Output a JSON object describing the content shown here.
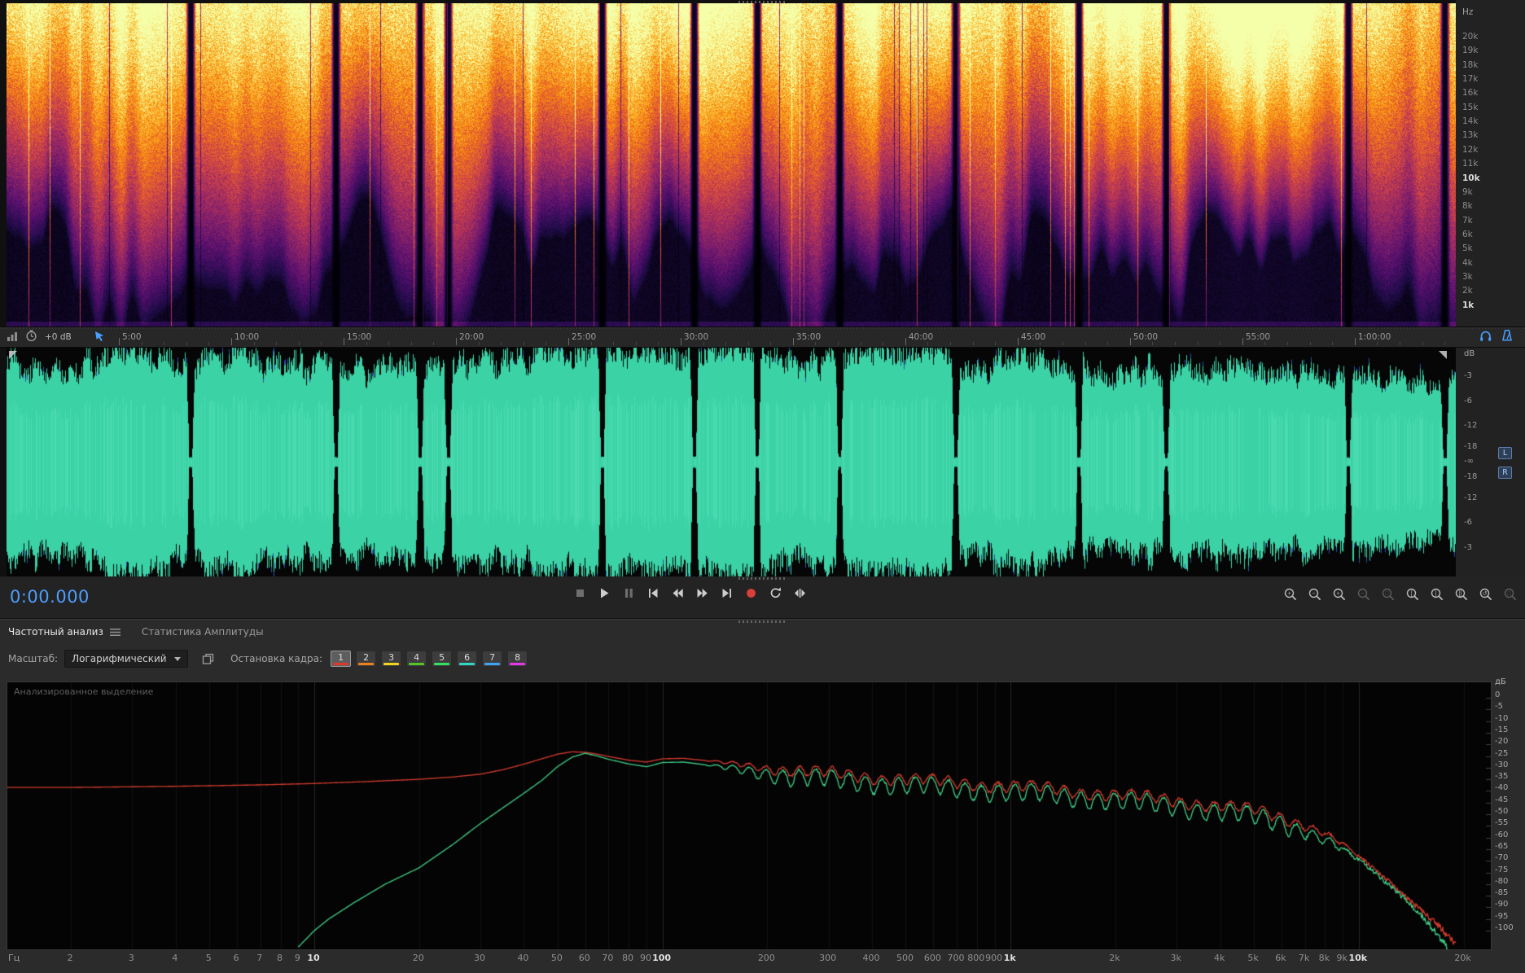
{
  "spectrogram": {
    "unit": "Hz",
    "freq_labels": [
      "20k",
      "19k",
      "18k",
      "17k",
      "16k",
      "15k",
      "14k",
      "13k",
      "12k",
      "11k",
      "10k",
      "9k",
      "8k",
      "7k",
      "6k",
      "5k",
      "4k",
      "3k",
      "2k",
      "1k"
    ],
    "bold_labels": [
      "10k",
      "1k"
    ]
  },
  "ruler": {
    "gain_label": "+0 dB",
    "interval_sec": 300,
    "times": [
      "5:00",
      "10:00",
      "15:00",
      "20:00",
      "25:00",
      "30:00",
      "35:00",
      "40:00",
      "45:00",
      "50:00",
      "55:00",
      "1:00:00"
    ]
  },
  "waveform": {
    "unit": "dB",
    "scale_labels": [
      "-3",
      "-6",
      "-12",
      "-18",
      "-∞",
      "-18",
      "-12",
      "-6",
      "-3"
    ],
    "channels": [
      "L",
      "R"
    ],
    "color": "#3bd2a5",
    "duration_sec": 3870,
    "gaps_sec": [
      491,
      879,
      1104,
      1179,
      1590,
      1836,
      2004,
      2224,
      2534,
      2863,
      3096,
      3582,
      3840
    ]
  },
  "transport": {
    "time_display": "0:00.000",
    "buttons": [
      {
        "name": "stop",
        "dim": true
      },
      {
        "name": "play",
        "dim": false
      },
      {
        "name": "pause",
        "dim": true
      },
      {
        "name": "skip-to-start",
        "dim": false
      },
      {
        "name": "rewind",
        "dim": false
      },
      {
        "name": "fast-forward",
        "dim": false
      },
      {
        "name": "skip-to-end",
        "dim": false
      },
      {
        "name": "record",
        "dim": false
      },
      {
        "name": "loop-playback",
        "dim": false
      },
      {
        "name": "skip-playhead",
        "dim": false
      }
    ],
    "zoom_buttons": [
      {
        "name": "zoom-in-time",
        "sub": "+",
        "dim": false
      },
      {
        "name": "zoom-out-time",
        "sub": "−",
        "dim": false
      },
      {
        "name": "zoom-in-amplitude",
        "sub": "+",
        "dim": false
      },
      {
        "name": "zoom-out-amplitude",
        "sub": "−",
        "dim": true
      },
      {
        "name": "zoom-to-selection",
        "sub": "□",
        "dim": true
      },
      {
        "name": "zoom-selection-in-point",
        "sub": "[",
        "dim": false
      },
      {
        "name": "zoom-selection-out-point",
        "sub": "]",
        "dim": false
      },
      {
        "name": "zoom-selection-full",
        "sub": "[]",
        "dim": false
      },
      {
        "name": "zoom-reset",
        "sub": "↺",
        "dim": false
      },
      {
        "name": "zoom-full-file",
        "sub": "□",
        "dim": true
      }
    ]
  },
  "panel": {
    "tabs": [
      {
        "label": "Частотный анализ",
        "active": true
      },
      {
        "label": "Статистика Амплитуды",
        "active": false
      }
    ],
    "scale_label": "Масштаб:",
    "scale_value": "Логарифмический",
    "hold_label": "Остановка кадра:",
    "hold_buttons": [
      {
        "label": "1",
        "color": "#e0392b",
        "selected": true
      },
      {
        "label": "2",
        "color": "#ef7f1a",
        "selected": false
      },
      {
        "label": "3",
        "color": "#f2d41b",
        "selected": false
      },
      {
        "label": "4",
        "color": "#58c229",
        "selected": false
      },
      {
        "label": "5",
        "color": "#2fe25f",
        "selected": false
      },
      {
        "label": "6",
        "color": "#2fd8c4",
        "selected": false
      },
      {
        "label": "7",
        "color": "#3da4f5",
        "selected": false
      },
      {
        "label": "8",
        "color": "#e736e7",
        "selected": false
      }
    ]
  },
  "chart_data": {
    "type": "line",
    "title": "Частотный анализ",
    "xlabel": "Гц",
    "ylabel": "дБ",
    "xscale": "log",
    "xlim_hz": [
      1.6,
      24000
    ],
    "ylim_db": [
      -108,
      2
    ],
    "grid": "vertical-log-ticks",
    "legend": "none",
    "overlay_label": "Анализированное выделение",
    "x_ticks": [
      {
        "f": 2,
        "label": "2",
        "bold": false
      },
      {
        "f": 3,
        "label": "3",
        "bold": false
      },
      {
        "f": 4,
        "label": "4",
        "bold": false
      },
      {
        "f": 5,
        "label": "5",
        "bold": false
      },
      {
        "f": 6,
        "label": "6",
        "bold": false
      },
      {
        "f": 7,
        "label": "7",
        "bold": false
      },
      {
        "f": 8,
        "label": "8",
        "bold": false
      },
      {
        "f": 9,
        "label": "9",
        "bold": false
      },
      {
        "f": 10,
        "label": "10",
        "bold": true
      },
      {
        "f": 20,
        "label": "20",
        "bold": false
      },
      {
        "f": 30,
        "label": "30",
        "bold": false
      },
      {
        "f": 40,
        "label": "40",
        "bold": false
      },
      {
        "f": 50,
        "label": "50",
        "bold": false
      },
      {
        "f": 60,
        "label": "60",
        "bold": false
      },
      {
        "f": 70,
        "label": "70",
        "bold": false
      },
      {
        "f": 80,
        "label": "80",
        "bold": false
      },
      {
        "f": 90,
        "label": "90",
        "bold": false
      },
      {
        "f": 100,
        "label": "100",
        "bold": true
      },
      {
        "f": 200,
        "label": "200",
        "bold": false
      },
      {
        "f": 300,
        "label": "300",
        "bold": false
      },
      {
        "f": 400,
        "label": "400",
        "bold": false
      },
      {
        "f": 500,
        "label": "500",
        "bold": false
      },
      {
        "f": 600,
        "label": "600",
        "bold": false
      },
      {
        "f": 700,
        "label": "700",
        "bold": false
      },
      {
        "f": 800,
        "label": "800",
        "bold": false
      },
      {
        "f": 900,
        "label": "900",
        "bold": false
      },
      {
        "f": 1000,
        "label": "1k",
        "bold": true
      },
      {
        "f": 2000,
        "label": "2k",
        "bold": false
      },
      {
        "f": 3000,
        "label": "3k",
        "bold": false
      },
      {
        "f": 4000,
        "label": "4k",
        "bold": false
      },
      {
        "f": 5000,
        "label": "5k",
        "bold": false
      },
      {
        "f": 6000,
        "label": "6k",
        "bold": false
      },
      {
        "f": 7000,
        "label": "7k",
        "bold": false
      },
      {
        "f": 8000,
        "label": "8k",
        "bold": false
      },
      {
        "f": 9000,
        "label": "9k",
        "bold": false
      },
      {
        "f": 10000,
        "label": "10k",
        "bold": true
      },
      {
        "f": 20000,
        "label": "20k",
        "bold": false
      }
    ],
    "y_ticks_db": [
      0,
      -5,
      -10,
      -15,
      -20,
      -25,
      -30,
      -35,
      -40,
      -45,
      -50,
      -55,
      -60,
      -65,
      -70,
      -75,
      -80,
      -85,
      -90,
      -95,
      -100
    ],
    "ripple": {
      "from_hz": 130,
      "to_hz": 11000,
      "per_decade": 21,
      "amp_db": {
        "red": 2.1,
        "green": 3.4
      }
    },
    "series": [
      {
        "name": "red",
        "color": "#cf3a2c",
        "from_edge": true,
        "points": [
          [
            2,
            -38.5
          ],
          [
            4,
            -38
          ],
          [
            7,
            -37.4
          ],
          [
            10,
            -36.8
          ],
          [
            14,
            -36
          ],
          [
            20,
            -35
          ],
          [
            25,
            -34
          ],
          [
            30,
            -32.8
          ],
          [
            35,
            -30.8
          ],
          [
            40,
            -28.5
          ],
          [
            45,
            -26.2
          ],
          [
            50,
            -24.2
          ],
          [
            55,
            -23.2
          ],
          [
            60,
            -23.4
          ],
          [
            65,
            -24.2
          ],
          [
            70,
            -25.2
          ],
          [
            80,
            -26.8
          ],
          [
            90,
            -27.6
          ],
          [
            100,
            -26.2
          ],
          [
            115,
            -26
          ],
          [
            130,
            -26.8
          ],
          [
            150,
            -27.8
          ],
          [
            175,
            -28.8
          ],
          [
            200,
            -29.8
          ],
          [
            250,
            -31.2
          ],
          [
            300,
            -32.2
          ],
          [
            400,
            -33.6
          ],
          [
            500,
            -34.6
          ],
          [
            650,
            -35.8
          ],
          [
            800,
            -36.6
          ],
          [
            1000,
            -37.6
          ],
          [
            1300,
            -38.8
          ],
          [
            1600,
            -40
          ],
          [
            2000,
            -41.2
          ],
          [
            2500,
            -42.6
          ],
          [
            3000,
            -43.8
          ],
          [
            4000,
            -46
          ],
          [
            5000,
            -48.2
          ],
          [
            6000,
            -51
          ],
          [
            7000,
            -54
          ],
          [
            8000,
            -58
          ],
          [
            9000,
            -63
          ],
          [
            10000,
            -68
          ],
          [
            11000,
            -73
          ],
          [
            12000,
            -78
          ],
          [
            13500,
            -85
          ],
          [
            15000,
            -91
          ],
          [
            17000,
            -98
          ],
          [
            19000,
            -106
          ]
        ]
      },
      {
        "name": "green",
        "color": "#3ecb85",
        "from_edge": false,
        "points": [
          [
            9,
            -107
          ],
          [
            10,
            -100
          ],
          [
            11,
            -95
          ],
          [
            13,
            -88
          ],
          [
            16,
            -80
          ],
          [
            20,
            -73
          ],
          [
            25,
            -63
          ],
          [
            30,
            -54
          ],
          [
            35,
            -47
          ],
          [
            40,
            -41
          ],
          [
            45,
            -35.5
          ],
          [
            50,
            -29.5
          ],
          [
            55,
            -25.5
          ],
          [
            60,
            -23.8
          ],
          [
            65,
            -25
          ],
          [
            70,
            -26.4
          ],
          [
            80,
            -28.4
          ],
          [
            90,
            -29.6
          ],
          [
            100,
            -27.8
          ],
          [
            115,
            -27.6
          ],
          [
            130,
            -28.6
          ],
          [
            150,
            -29.8
          ],
          [
            175,
            -31
          ],
          [
            200,
            -32.2
          ],
          [
            250,
            -33.6
          ],
          [
            300,
            -34.6
          ],
          [
            400,
            -36
          ],
          [
            500,
            -37
          ],
          [
            650,
            -38.2
          ],
          [
            800,
            -39
          ],
          [
            1000,
            -40
          ],
          [
            1300,
            -41.2
          ],
          [
            1600,
            -42.4
          ],
          [
            2000,
            -43.6
          ],
          [
            2500,
            -45
          ],
          [
            3000,
            -46.2
          ],
          [
            4000,
            -48.4
          ],
          [
            5000,
            -50.6
          ],
          [
            6000,
            -53.4
          ],
          [
            7000,
            -56.5
          ],
          [
            8000,
            -60.5
          ],
          [
            9000,
            -65
          ],
          [
            10000,
            -69.5
          ],
          [
            11000,
            -74.5
          ],
          [
            12000,
            -79.5
          ],
          [
            13500,
            -86
          ],
          [
            15000,
            -93
          ],
          [
            16500,
            -100
          ],
          [
            18000,
            -107
          ]
        ]
      }
    ]
  }
}
